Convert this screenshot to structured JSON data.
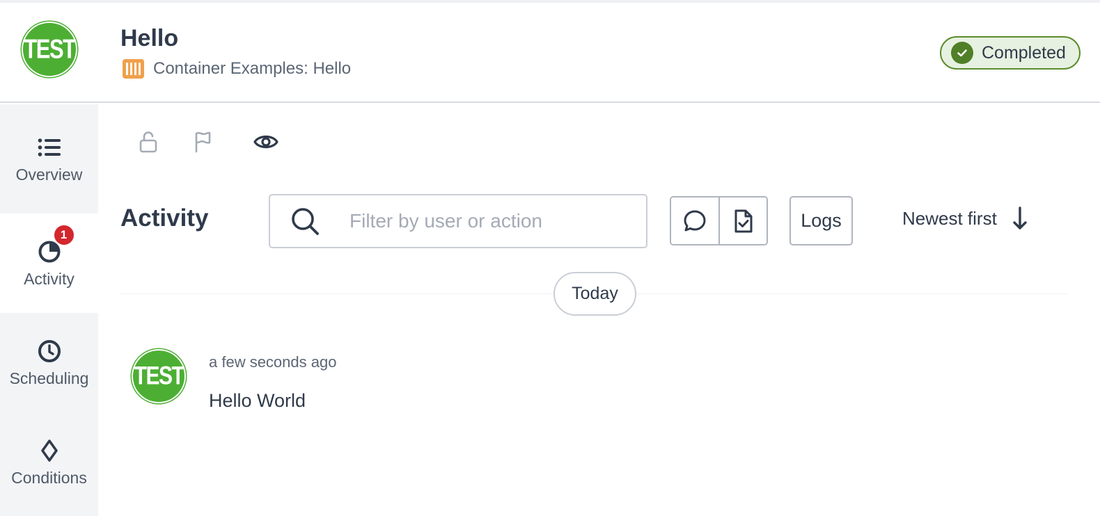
{
  "header": {
    "avatar_text": "TEST",
    "title": "Hello",
    "subtitle": "Container Examples: Hello",
    "status": "Completed"
  },
  "sidebar": {
    "items": [
      {
        "label": "Overview",
        "icon": "list-icon",
        "active": false
      },
      {
        "label": "Activity",
        "icon": "activity-icon",
        "active": true,
        "badge": "1"
      },
      {
        "label": "Scheduling",
        "icon": "clock-icon",
        "active": false
      },
      {
        "label": "Conditions",
        "icon": "diamond-icon",
        "active": false
      }
    ]
  },
  "toolbar": {
    "icons": [
      "unlock-icon",
      "flag-icon",
      "eye-icon"
    ]
  },
  "activity": {
    "title": "Activity",
    "search_placeholder": "Filter by user or action",
    "filter_buttons": [
      "comment-icon",
      "file-check-icon"
    ],
    "logs_label": "Logs",
    "sort_label": "Newest first",
    "date_divider": "Today",
    "entries": [
      {
        "avatar_text": "TEST",
        "time": "a few seconds ago",
        "text": "Hello World"
      }
    ]
  },
  "colors": {
    "brand_green": "#4caf33",
    "status_border": "#5b8c2a",
    "status_bg": "#e7f1e1",
    "badge_red": "#d3272e",
    "container_orange": "#f0a04b",
    "text_dark": "#2f3a4a"
  }
}
